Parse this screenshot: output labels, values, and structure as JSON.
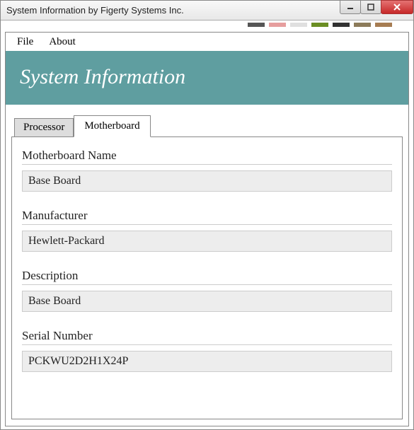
{
  "window": {
    "title": "System Information by Figerty Systems Inc."
  },
  "menu": {
    "file": "File",
    "about": "About"
  },
  "header": {
    "title": "System Information"
  },
  "tabs": {
    "processor": "Processor",
    "motherboard": "Motherboard"
  },
  "fields": {
    "name_label": "Motherboard Name",
    "name_value": "Base Board",
    "manufacturer_label": "Manufacturer",
    "manufacturer_value": "Hewlett-Packard",
    "description_label": "Description",
    "description_value": "Base Board",
    "serial_label": "Serial Number",
    "serial_value": "PCKWU2D2H1X24P"
  },
  "swatches": [
    "#555",
    "#e69e9e",
    "#e0e0e0",
    "#6b8e23",
    "#333",
    "#8c7b5a",
    "#a67c52"
  ]
}
